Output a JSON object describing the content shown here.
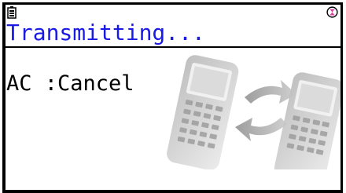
{
  "header": {
    "battery_icon": "battery-icon",
    "busy_icon": "busy-indicator-icon"
  },
  "dialog": {
    "title": "Transmitting...",
    "cancel_hint": "AC :Cancel"
  },
  "illustration": {
    "icon": "calculator-transfer-icon"
  },
  "colors": {
    "title": "#1a1ae6",
    "busy_icon": "#e040a0"
  }
}
